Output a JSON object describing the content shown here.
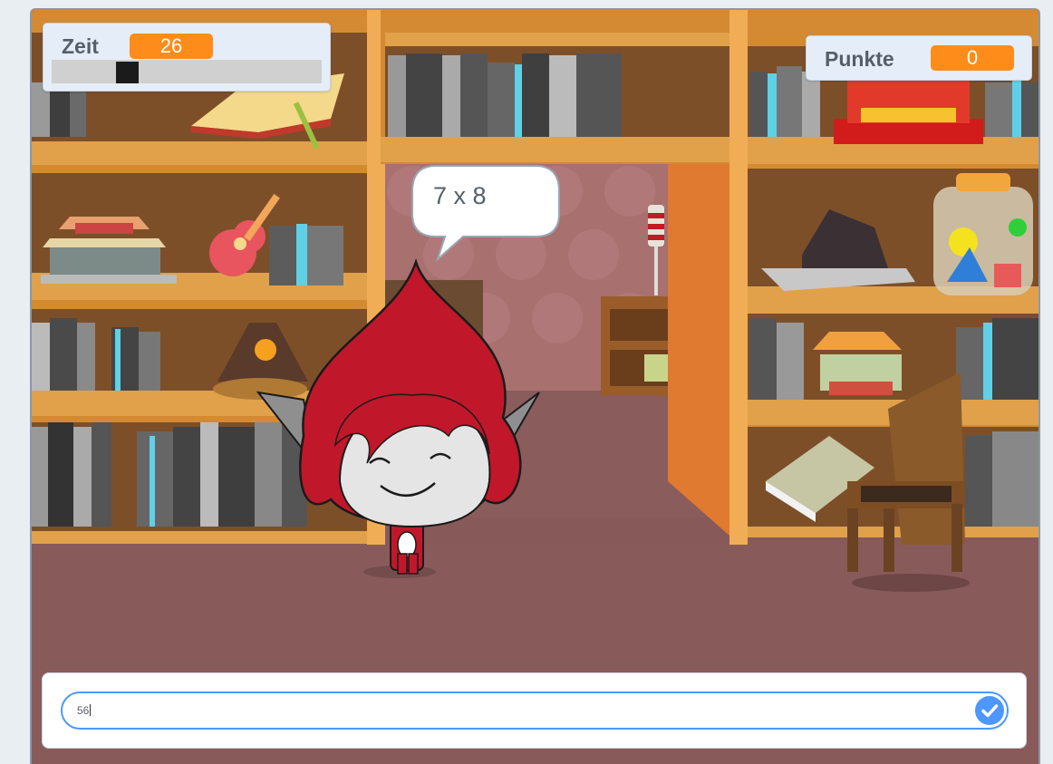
{
  "monitors": {
    "zeit": {
      "label": "Zeit",
      "value": "26",
      "slider_level": 0.26
    },
    "punkte": {
      "label": "Punkte",
      "value": "0"
    }
  },
  "speech_bubble": {
    "text": "7 x 8"
  },
  "ask": {
    "value": "56"
  },
  "icons": {
    "submit": "checkmark-icon"
  },
  "colors": {
    "monitor_value": "#fd8c1a",
    "input_border": "#4d97ff",
    "check_button": "#4d97ff",
    "sprite_red": "#c1172a"
  }
}
